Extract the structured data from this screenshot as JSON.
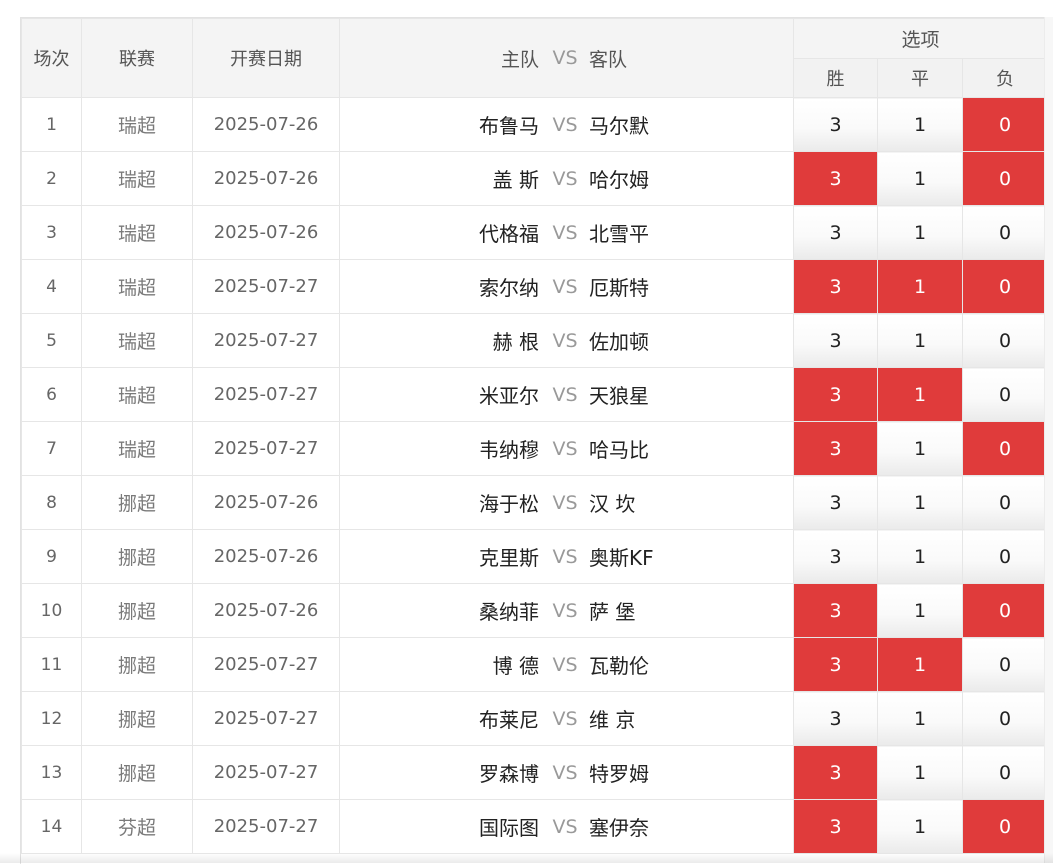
{
  "headers": {
    "idx": "场次",
    "league": "联赛",
    "date": "开赛日期",
    "match_home": "主队",
    "match_vs": "VS",
    "match_away": "客队",
    "options": "选项",
    "win": "胜",
    "draw": "平",
    "lose": "负"
  },
  "colors": {
    "selected": "#e03b3b",
    "header_bg": "#f4f4f4"
  },
  "rows": [
    {
      "idx": "1",
      "league": "瑞超",
      "date": "2025-07-26",
      "home": "布鲁马",
      "vs": "VS",
      "away": "马尔默",
      "win": "3",
      "draw": "1",
      "lose": "0",
      "sel": [
        false,
        false,
        true
      ]
    },
    {
      "idx": "2",
      "league": "瑞超",
      "date": "2025-07-26",
      "home": "盖 斯",
      "vs": "VS",
      "away": "哈尔姆",
      "win": "3",
      "draw": "1",
      "lose": "0",
      "sel": [
        true,
        false,
        true
      ]
    },
    {
      "idx": "3",
      "league": "瑞超",
      "date": "2025-07-26",
      "home": "代格福",
      "vs": "VS",
      "away": "北雪平",
      "win": "3",
      "draw": "1",
      "lose": "0",
      "sel": [
        false,
        false,
        false
      ]
    },
    {
      "idx": "4",
      "league": "瑞超",
      "date": "2025-07-27",
      "home": "索尔纳",
      "vs": "VS",
      "away": "厄斯特",
      "win": "3",
      "draw": "1",
      "lose": "0",
      "sel": [
        true,
        true,
        true
      ]
    },
    {
      "idx": "5",
      "league": "瑞超",
      "date": "2025-07-27",
      "home": "赫 根",
      "vs": "VS",
      "away": "佐加顿",
      "win": "3",
      "draw": "1",
      "lose": "0",
      "sel": [
        false,
        false,
        false
      ]
    },
    {
      "idx": "6",
      "league": "瑞超",
      "date": "2025-07-27",
      "home": "米亚尔",
      "vs": "VS",
      "away": "天狼星",
      "win": "3",
      "draw": "1",
      "lose": "0",
      "sel": [
        true,
        true,
        false
      ]
    },
    {
      "idx": "7",
      "league": "瑞超",
      "date": "2025-07-27",
      "home": "韦纳穆",
      "vs": "VS",
      "away": "哈马比",
      "win": "3",
      "draw": "1",
      "lose": "0",
      "sel": [
        true,
        false,
        true
      ]
    },
    {
      "idx": "8",
      "league": "挪超",
      "date": "2025-07-26",
      "home": "海于松",
      "vs": "VS",
      "away": "汉 坎",
      "win": "3",
      "draw": "1",
      "lose": "0",
      "sel": [
        false,
        false,
        false
      ]
    },
    {
      "idx": "9",
      "league": "挪超",
      "date": "2025-07-26",
      "home": "克里斯",
      "vs": "VS",
      "away": "奥斯KF",
      "win": "3",
      "draw": "1",
      "lose": "0",
      "sel": [
        false,
        false,
        false
      ]
    },
    {
      "idx": "10",
      "league": "挪超",
      "date": "2025-07-26",
      "home": "桑纳菲",
      "vs": "VS",
      "away": "萨 堡",
      "win": "3",
      "draw": "1",
      "lose": "0",
      "sel": [
        true,
        false,
        true
      ]
    },
    {
      "idx": "11",
      "league": "挪超",
      "date": "2025-07-27",
      "home": "博 德",
      "vs": "VS",
      "away": "瓦勒伦",
      "win": "3",
      "draw": "1",
      "lose": "0",
      "sel": [
        true,
        true,
        false
      ]
    },
    {
      "idx": "12",
      "league": "挪超",
      "date": "2025-07-27",
      "home": "布莱尼",
      "vs": "VS",
      "away": "维 京",
      "win": "3",
      "draw": "1",
      "lose": "0",
      "sel": [
        false,
        false,
        false
      ]
    },
    {
      "idx": "13",
      "league": "挪超",
      "date": "2025-07-27",
      "home": "罗森博",
      "vs": "VS",
      "away": "特罗姆",
      "win": "3",
      "draw": "1",
      "lose": "0",
      "sel": [
        true,
        false,
        false
      ]
    },
    {
      "idx": "14",
      "league": "芬超",
      "date": "2025-07-27",
      "home": "国际图",
      "vs": "VS",
      "away": "塞伊奈",
      "win": "3",
      "draw": "1",
      "lose": "0",
      "sel": [
        true,
        false,
        true
      ]
    }
  ]
}
